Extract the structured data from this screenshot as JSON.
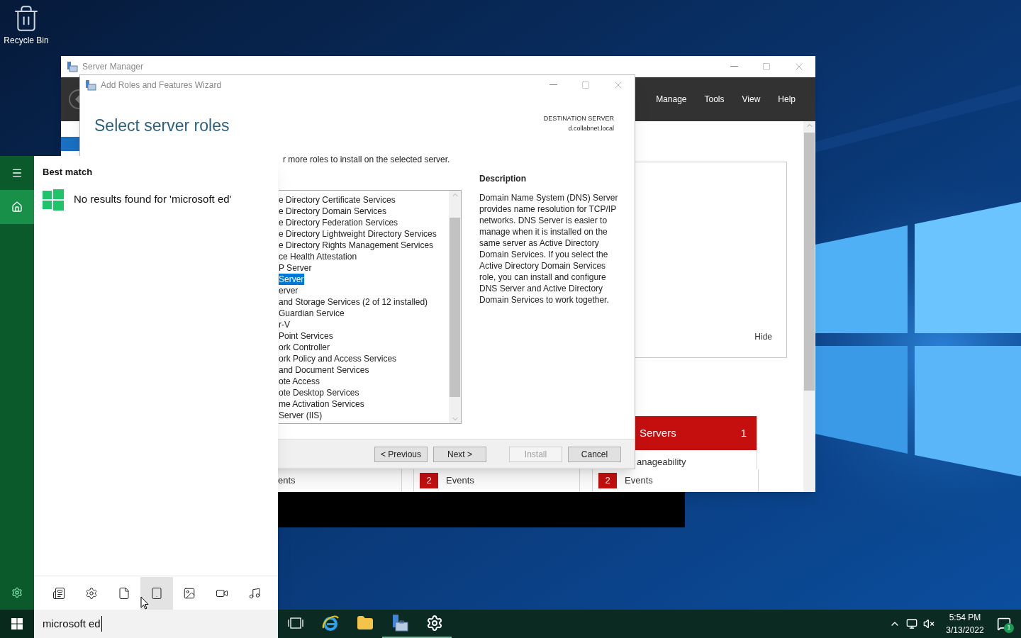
{
  "desktop": {
    "icons": [
      {
        "label": "Recycle Bin"
      }
    ]
  },
  "server_manager": {
    "title": "Server Manager",
    "menu": [
      "Manage",
      "Tools",
      "View",
      "Help"
    ],
    "panel_action": "Hide",
    "servers_tile": {
      "title": "Servers",
      "count": "1",
      "row": "anageability"
    },
    "event_cells": [
      {
        "label": "ents"
      },
      {
        "badge": "2",
        "label": "Events"
      },
      {
        "badge": "2",
        "label": "Events"
      }
    ]
  },
  "wizard": {
    "title": "Add Roles and Features Wizard",
    "heading": "Select server roles",
    "destination_label": "DESTINATION SERVER",
    "destination_value": "d.collabnet.local",
    "instruction": "r more roles to install on the selected server.",
    "roles": [
      {
        "label": "e Directory Certificate Services",
        "selected": false
      },
      {
        "label": "e Directory Domain Services",
        "selected": false
      },
      {
        "label": "e Directory Federation Services",
        "selected": false
      },
      {
        "label": "e Directory Lightweight Directory Services",
        "selected": false
      },
      {
        "label": "e Directory Rights Management Services",
        "selected": false
      },
      {
        "label": "ce Health Attestation",
        "selected": false
      },
      {
        "label": "P Server",
        "selected": false
      },
      {
        "label": "Server",
        "selected": true
      },
      {
        "label": "erver",
        "selected": false
      },
      {
        "label": "and Storage Services (2 of 12 installed)",
        "selected": false
      },
      {
        "label": "Guardian Service",
        "selected": false
      },
      {
        "label": "r-V",
        "selected": false
      },
      {
        "label": "Point Services",
        "selected": false
      },
      {
        "label": "ork Controller",
        "selected": false
      },
      {
        "label": "ork Policy and Access Services",
        "selected": false
      },
      {
        "label": "and Document Services",
        "selected": false
      },
      {
        "label": "ote Access",
        "selected": false
      },
      {
        "label": "ote Desktop Services",
        "selected": false
      },
      {
        "label": "me Activation Services",
        "selected": false
      },
      {
        "label": "Server (IIS)",
        "selected": false
      }
    ],
    "description_title": "Description",
    "description": "Domain Name System (DNS) Server provides name resolution for TCP/IP networks. DNS Server is easier to manage when it is installed on the same server as Active Directory Domain Services. If you select the Active Directory Domain Services role, you can install and configure DNS Server and Active Directory Domain Services to work together.",
    "buttons": [
      {
        "label": "< Previous",
        "disabled": false
      },
      {
        "label": "Next >",
        "disabled": false
      },
      {
        "label": "Install",
        "disabled": true
      },
      {
        "label": "Cancel",
        "disabled": false
      }
    ]
  },
  "search": {
    "sidebar": [
      {
        "kind": "menu",
        "selected": false
      },
      {
        "kind": "home",
        "selected": true
      },
      {
        "kind": "settings",
        "selected": false
      }
    ],
    "heading": "Best match",
    "result": "No results found for 'microsoft ed'",
    "filters": [
      {
        "kind": "apps",
        "selected": false
      },
      {
        "kind": "settings",
        "selected": false
      },
      {
        "kind": "documents",
        "selected": false
      },
      {
        "kind": "folders",
        "selected": true
      },
      {
        "kind": "photos",
        "selected": false
      },
      {
        "kind": "videos",
        "selected": false
      },
      {
        "kind": "music",
        "selected": false
      }
    ],
    "query": "microsoft ed"
  },
  "taskbar": {
    "apps": [
      {
        "kind": "taskview",
        "running": false
      },
      {
        "kind": "browser",
        "running": false
      },
      {
        "kind": "explorer",
        "running": false
      },
      {
        "kind": "servermanager",
        "running": true
      },
      {
        "kind": "settings",
        "running": true
      }
    ],
    "time": "5:54 PM",
    "date": "3/13/2022",
    "notifications": "1"
  }
}
